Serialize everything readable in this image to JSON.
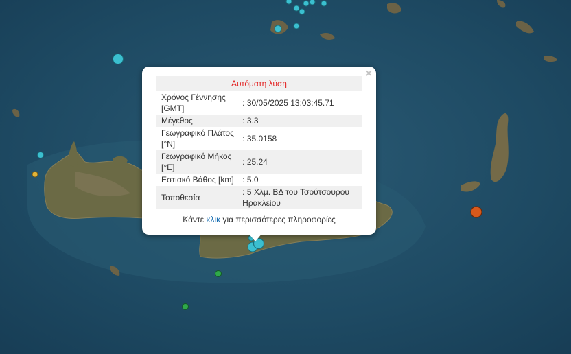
{
  "popup": {
    "title": "Αυτόματη λύση",
    "close_label": "×",
    "rows": [
      {
        "label": "Χρόνος Γέννησης [GMT]",
        "value": ": 30/05/2025 13:03:45.71"
      },
      {
        "label": "Μέγεθος",
        "value": ": 3.3"
      },
      {
        "label": "Γεωγραφικό Πλάτος [°N]",
        "value": ": 35.0158"
      },
      {
        "label": "Γεωγραφικό Μήκος [°E]",
        "value": ": 25.24"
      },
      {
        "label": "Εστιακό Βάθος [km]",
        "value": ": 5.0"
      },
      {
        "label": "Τοποθεσία",
        "value": ": 5 Χλμ. ΒΔ του Τσούτσουρου Ηρακλείου"
      }
    ],
    "more_prefix": "Κάντε",
    "more_link": "κλικ",
    "more_suffix": "για περισσότερες πληροφορίες"
  },
  "colors": {
    "sea": "#1f4a64",
    "land": "#6e6a44",
    "marker_recent": "#3bbfd0",
    "marker_older": "#2fa84a",
    "marker_yellow": "#e0b43a",
    "marker_orange": "#d8591b",
    "title_red": "#e32222",
    "link_blue": "#1a6fb3"
  }
}
